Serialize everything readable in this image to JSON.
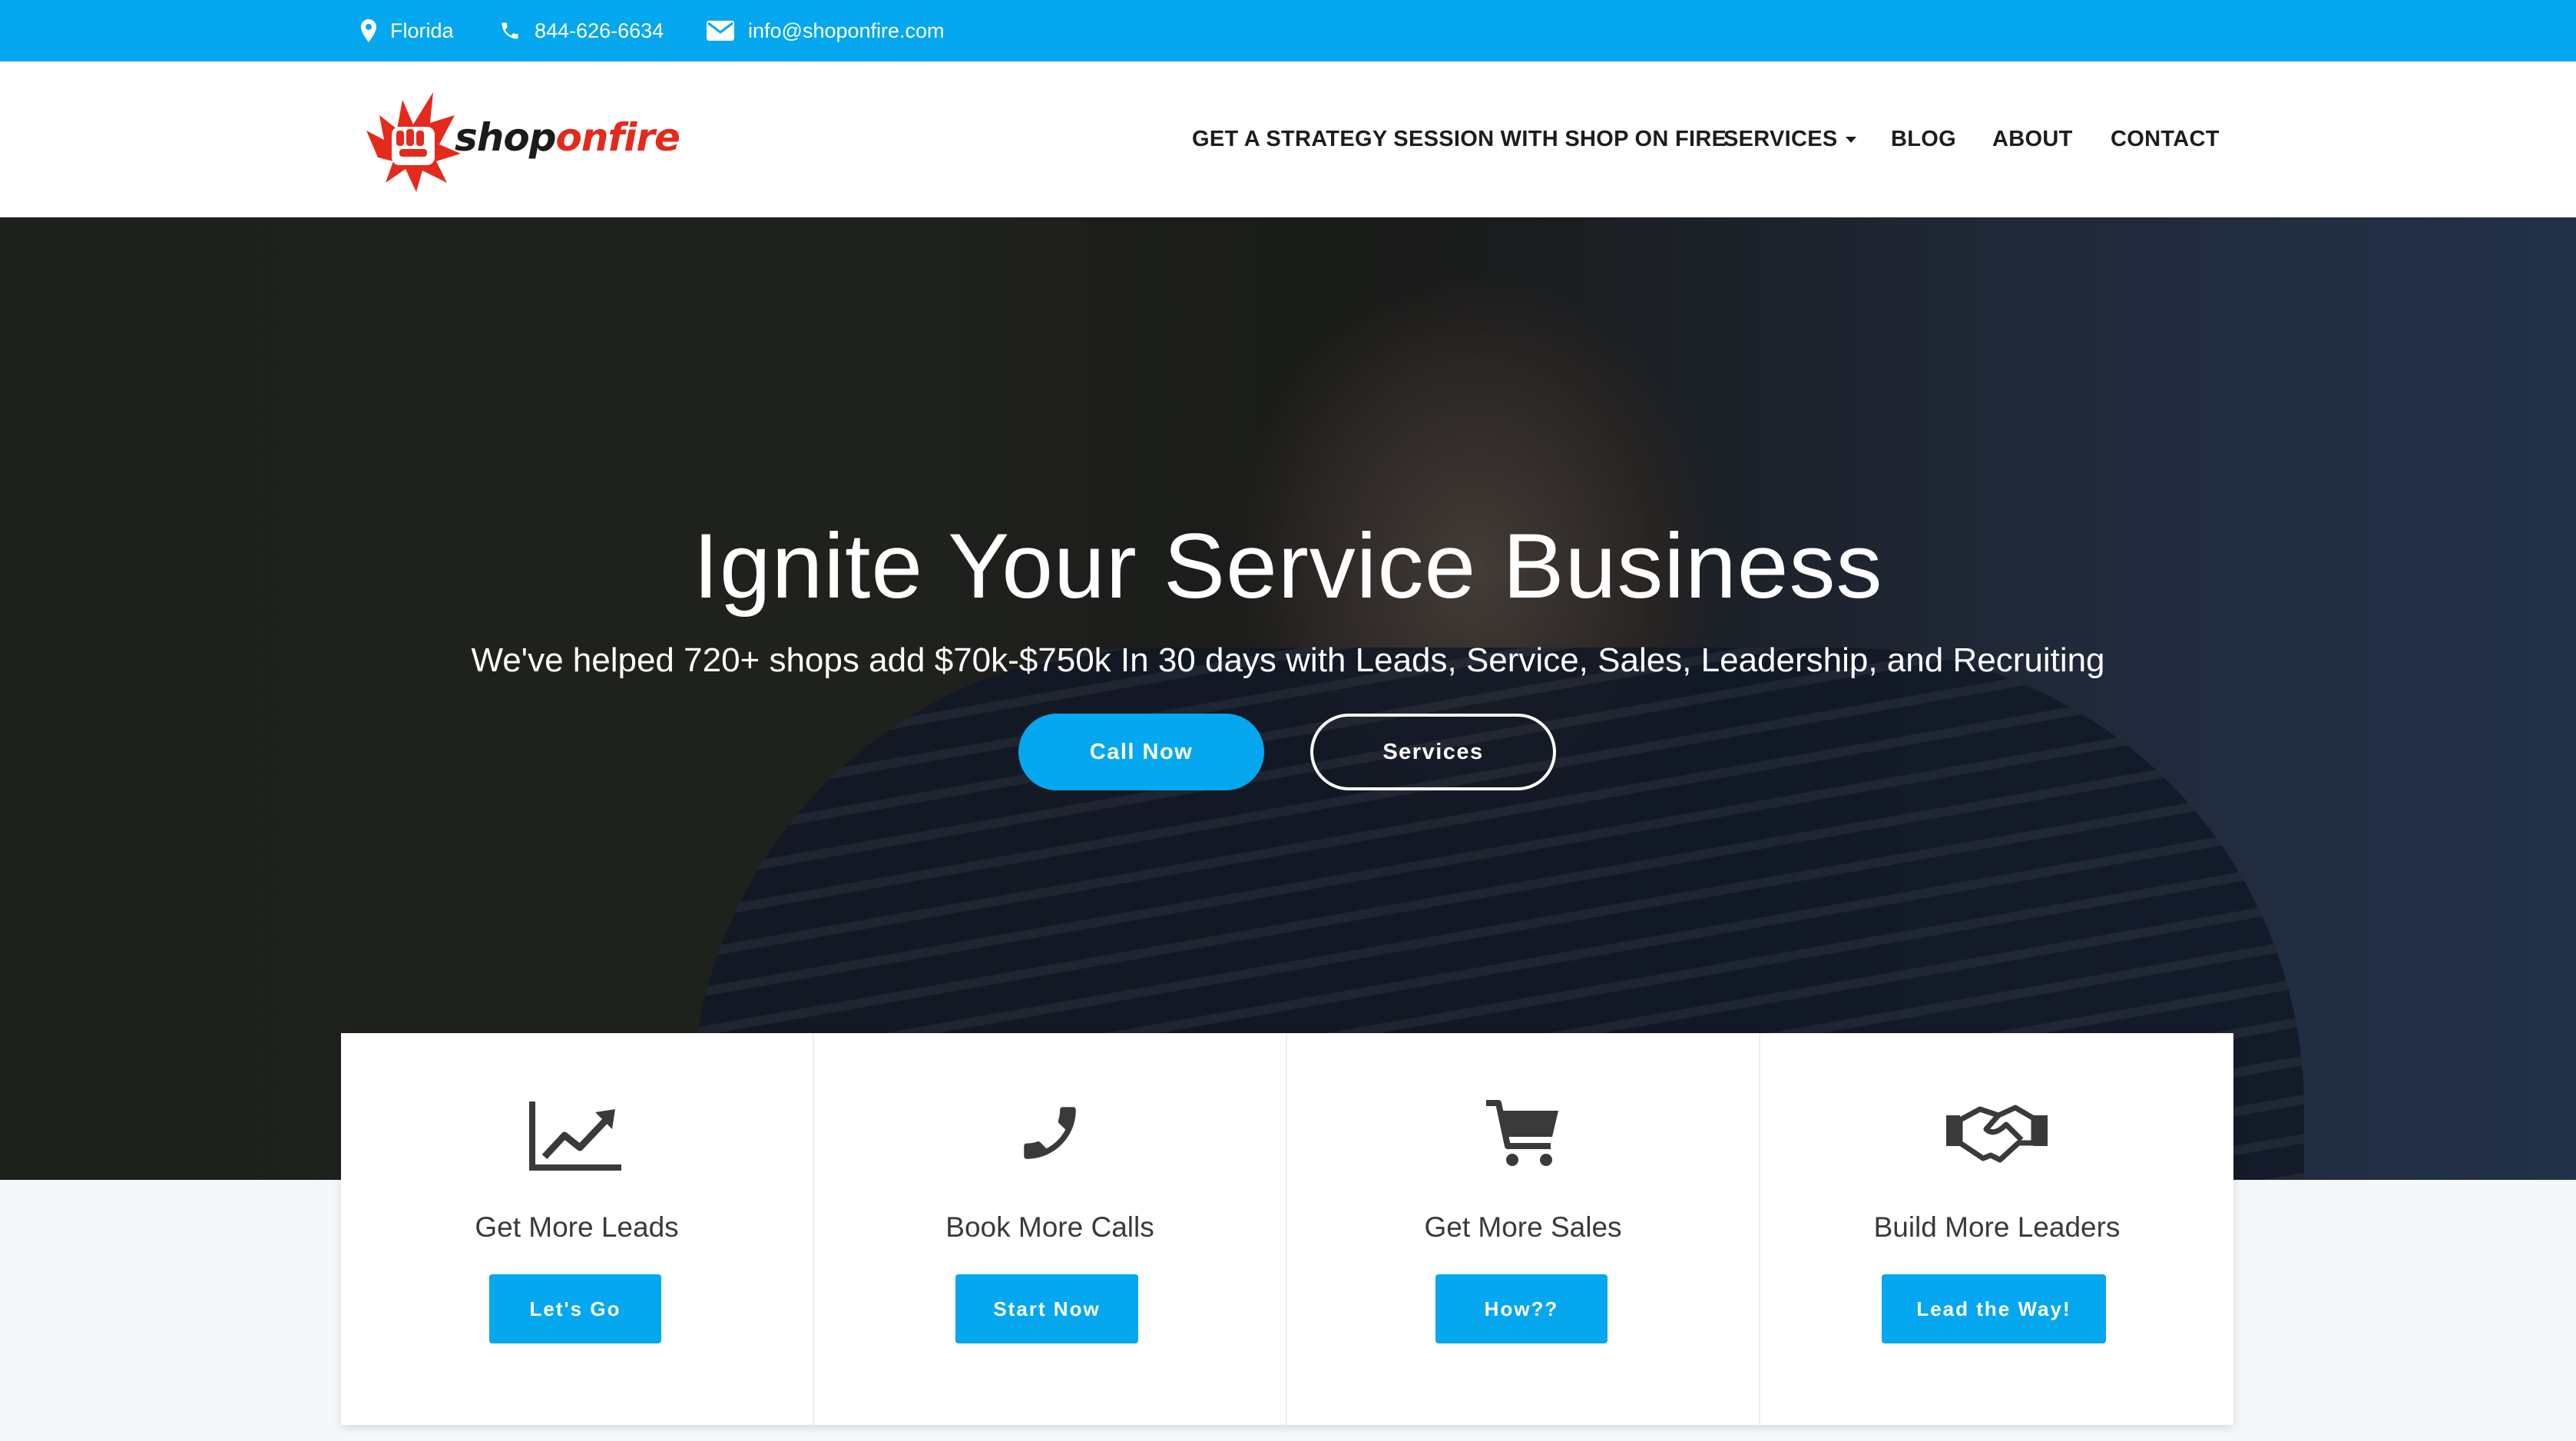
{
  "topbar": {
    "location": "Florida",
    "phone": "844-626-6634",
    "email": "info@shoponfire.com"
  },
  "header": {
    "logo": {
      "text_part1": "shop",
      "text_part2": "onfire"
    },
    "nav": {
      "strategy": "GET A STRATEGY SESSION WITH SHOP ON FIRE",
      "services": "SERVICES",
      "blog": "BLOG",
      "about": "ABOUT",
      "contact": "CONTACT"
    }
  },
  "hero": {
    "title": "Ignite Your Service Business",
    "subtitle": "We've helped 720+ shops add $70k-$750k In 30 days with Leads, Service, Sales, Leadership, and Recruiting",
    "call_button": "Call Now",
    "services_button": "Services"
  },
  "cards": [
    {
      "icon": "line-chart-icon",
      "title": "Get More Leads",
      "button": "Let's Go"
    },
    {
      "icon": "phone-icon",
      "title": "Book More Calls",
      "button": "Start Now"
    },
    {
      "icon": "cart-icon",
      "title": "Get More Sales",
      "button": "How??"
    },
    {
      "icon": "handshake-icon",
      "title": "Build More Leaders",
      "button": "Lead the Way!"
    }
  ],
  "colors": {
    "accent": "#05a7ef",
    "brand_red": "#e32a1c",
    "text_dark": "#1d1d1d"
  }
}
